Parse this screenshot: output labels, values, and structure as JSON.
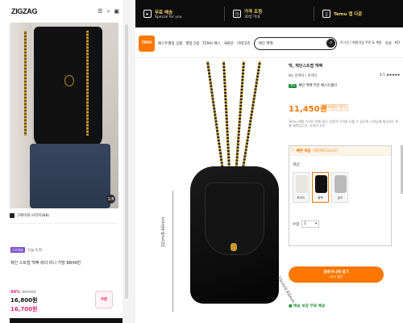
{
  "mobile": {
    "logo": "ZIGZAG",
    "header_icons": [
      "hamburger-icon",
      "search-icon",
      "cart-icon"
    ],
    "seller": "고메이와 브리지(NB)",
    "photo_badge": "1/8",
    "tag": "무료배송",
    "tag_text": "오늘 도착",
    "title": "체인 스트랩 백팩 레더 미니 가방 BB49번",
    "discount_pct": "44%",
    "old_price": "30,000",
    "price": "16,800원",
    "price_highlight": "16,700원",
    "coupon": "쿠폰"
  },
  "desktop": {
    "promo": [
      {
        "title": "무료 배송",
        "sub": "Special for you"
      },
      {
        "title": "가격 조정",
        "sub": "30일 이내"
      },
      {
        "title": "Temu 앱 다운",
        "sub": ""
      }
    ],
    "nav": {
      "logo": "TEMU",
      "items": [
        "베스트셀링 상품",
        "별점 5점",
        "TEMU 패스",
        "새로운",
        "카테고리"
      ],
      "search_value": "체인 백팩",
      "account": "로그인 / 회원가입\n주문 & 계정",
      "support": "지원",
      "language": "KO"
    },
    "product": {
      "breadcrumb": "백, 체인스트랩 백팩",
      "brand": "NU 판매처 | 판매자",
      "rating": "4.5",
      "stars": "★★★★★",
      "best_label": "#1",
      "best_text": "체인 백팩 부문 베스트셀러",
      "price": "11,450원",
      "price_old": "45%할인 정가",
      "desc": "Temu 체험 가격은 판매 중인 상품의 가격과 다를 수 있으며 고객님께 제공되는 특별 혜택입니다. 자세히 보기",
      "deal_head": "빠른 세일",
      "deal_sub": "마감까지 12시간",
      "color_label": "색상:",
      "swatches": [
        {
          "label": "화이트",
          "color": "#e9e5df",
          "selected": false
        },
        {
          "label": "블랙",
          "color": "#111111",
          "selected": true
        },
        {
          "label": "실버",
          "color": "#b9b9b9",
          "selected": false
        }
      ],
      "qty_label": "수량",
      "qty_value": "1",
      "cta_main": "장바구니에 담기",
      "cta_sub": "45% 할인",
      "ship": "배송 보장 무료 배송",
      "dimension_vertical": "22cm/8.66inch",
      "dimension_depth": "10cm/3.93inch"
    }
  }
}
